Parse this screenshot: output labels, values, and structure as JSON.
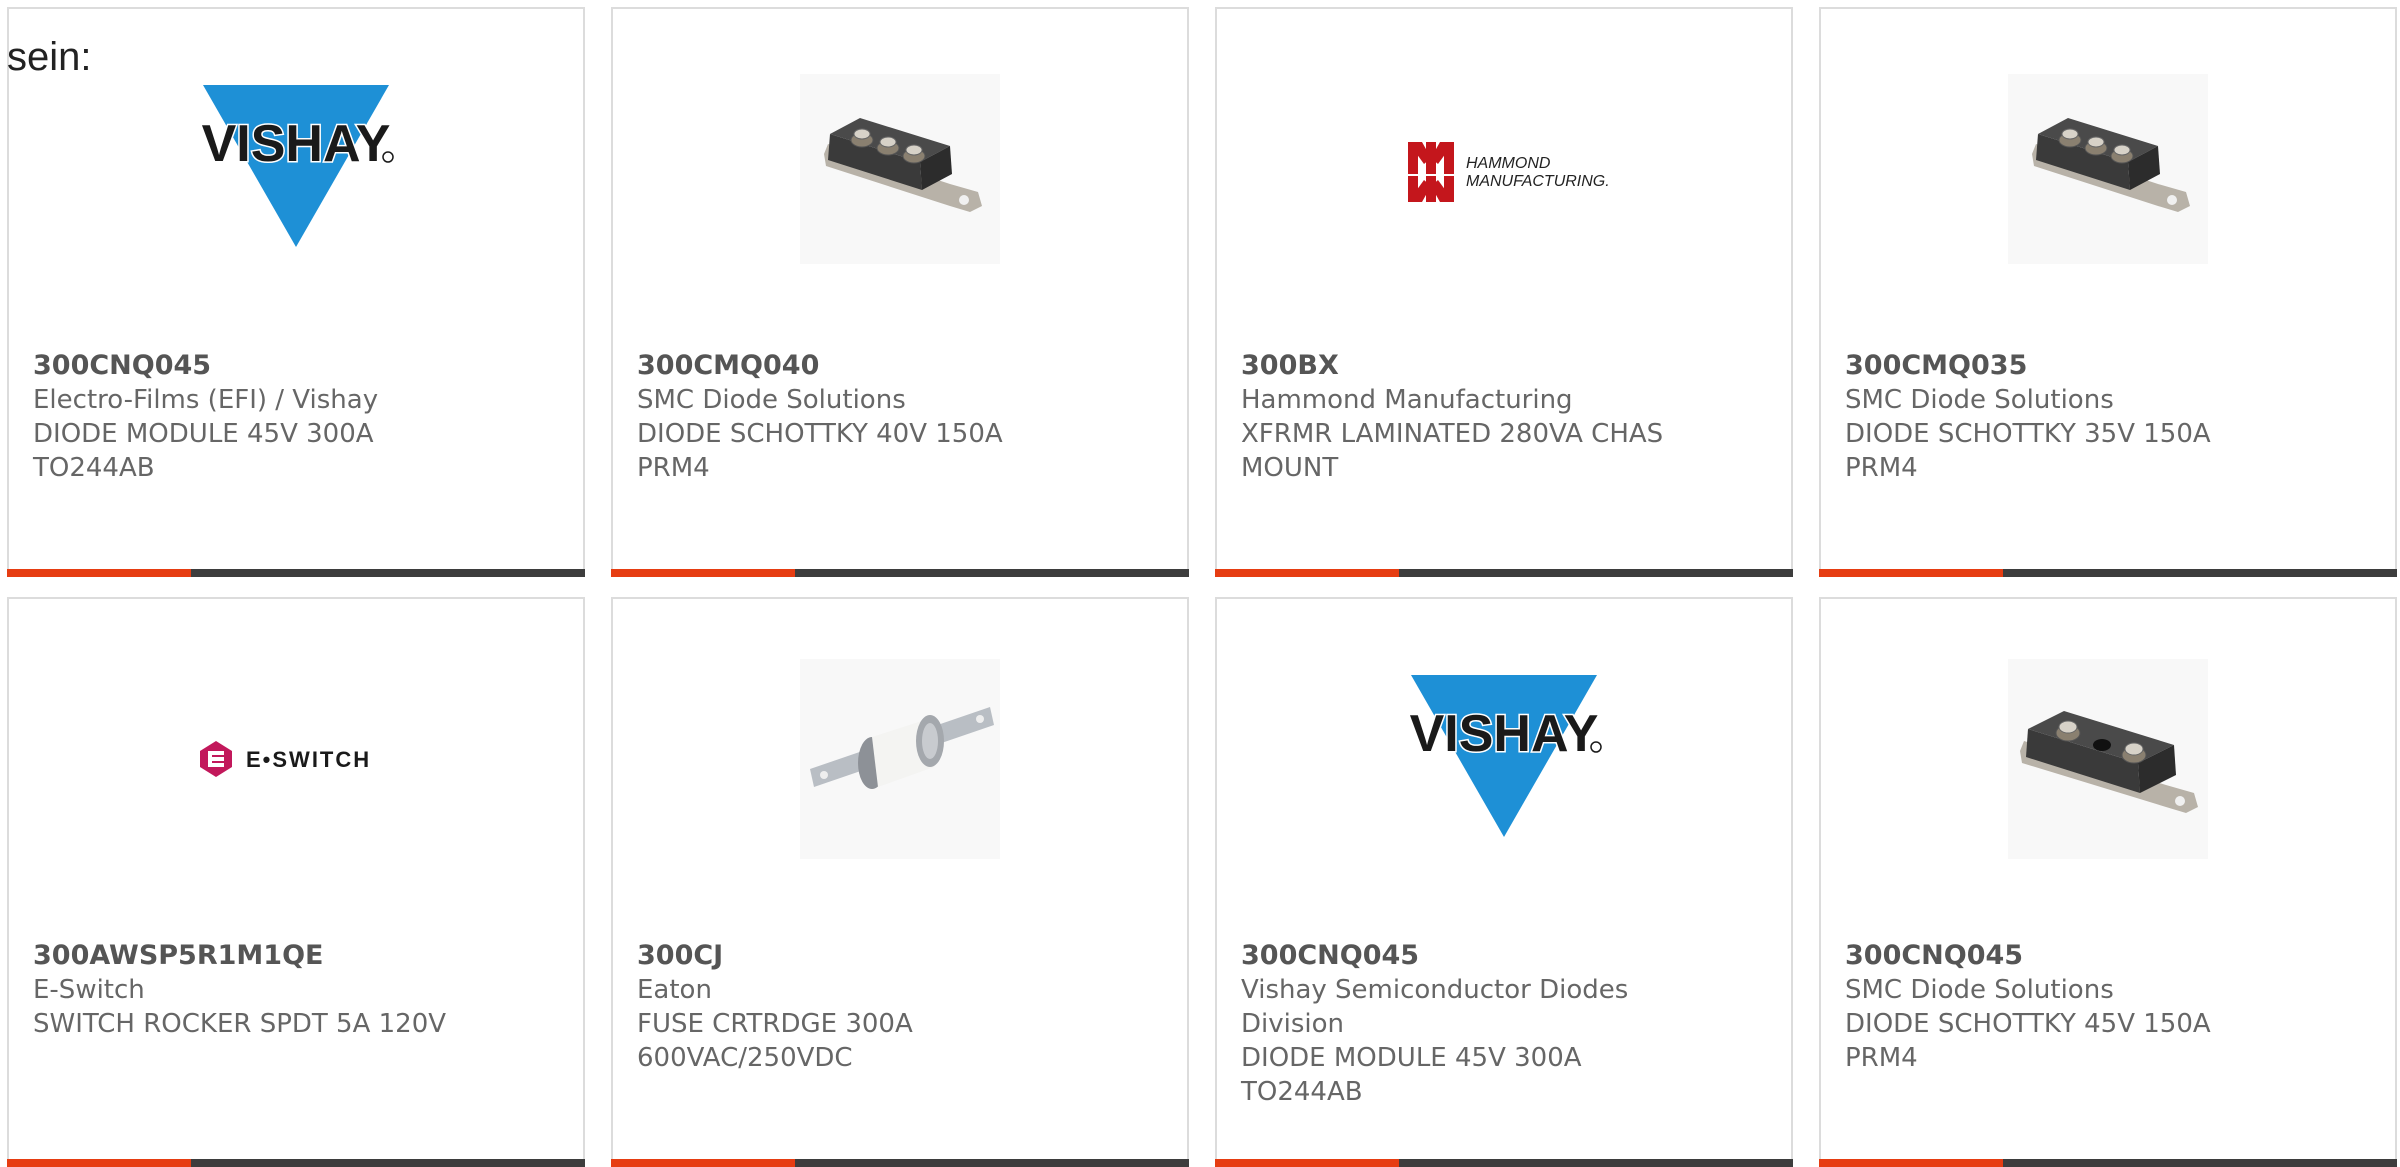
{
  "prefix_text": "sein:",
  "colors": {
    "accent": "#e63d12",
    "bar": "#3d3d3d",
    "border": "#dcdcdc",
    "text": "#666666",
    "vishay_blue": "#1e90d6",
    "hammond_red": "#c4161c",
    "eswitch_magenta": "#c2185b"
  },
  "products": [
    {
      "image": "vishay-logo",
      "part_number": "300CNQ045",
      "manufacturer": "Electro-Films (EFI) / Vishay",
      "description_line1": "DIODE MODULE 45V 300A",
      "description_line2": "TO244AB"
    },
    {
      "image": "diode-module-three-terminal",
      "part_number": "300CMQ040",
      "manufacturer": "SMC Diode Solutions",
      "description_line1": "DIODE SCHOTTKY 40V 150A",
      "description_line2": "PRM4"
    },
    {
      "image": "hammond-logo",
      "logo_text": "HAMMOND MANUFACTURING.",
      "part_number": "300BX",
      "manufacturer": "Hammond Manufacturing",
      "description_line1": "XFRMR LAMINATED 280VA CHAS",
      "description_line2": "MOUNT"
    },
    {
      "image": "diode-module-three-terminal",
      "part_number": "300CMQ035",
      "manufacturer": "SMC Diode Solutions",
      "description_line1": "DIODE SCHOTTKY 35V 150A",
      "description_line2": "PRM4"
    },
    {
      "image": "eswitch-logo",
      "logo_text": "E•SWITCH",
      "part_number": "300AWSP5R1M1QE",
      "manufacturer": "E-Switch",
      "description_line1": "SWITCH ROCKER SPDT 5A 120V",
      "description_line2": ""
    },
    {
      "image": "fuse-cartridge",
      "part_number": "300CJ",
      "manufacturer": "Eaton",
      "description_line1": "FUSE CRTRDGE 300A",
      "description_line2": "600VAC/250VDC"
    },
    {
      "image": "vishay-logo",
      "part_number": "300CNQ045",
      "manufacturer": "Vishay Semiconductor Diodes",
      "manufacturer_line2": "Division",
      "description_line1": "DIODE MODULE 45V 300A",
      "description_line2": "TO244AB"
    },
    {
      "image": "diode-module-two-terminal",
      "part_number": "300CNQ045",
      "manufacturer": "SMC Diode Solutions",
      "description_line1": "DIODE SCHOTTKY 45V 150A",
      "description_line2": "PRM4"
    }
  ]
}
